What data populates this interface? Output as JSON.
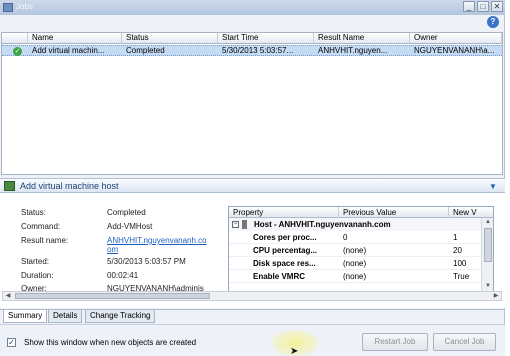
{
  "window": {
    "title": "Jobs"
  },
  "grid": {
    "columns": [
      "Name",
      "Status",
      "Start Time",
      "Result Name",
      "Owner"
    ],
    "rows": [
      {
        "name": "Add virtual machin...",
        "status": "Completed",
        "start_time": "5/30/2013 5:03:57...",
        "result_name": "ANHVHIT.nguyen...",
        "owner": "NGUYENVANANH\\a..."
      }
    ]
  },
  "details": {
    "title": "Add virtual machine host",
    "fields": [
      {
        "label": "Status:",
        "value": "Completed"
      },
      {
        "label": "Command:",
        "value": "Add-VMHost"
      },
      {
        "label": "Result name:",
        "value": "ANHVHIT.nguyenvananh.co",
        "value2": "om"
      },
      {
        "label": "Started:",
        "value": "5/30/2013 5:03:57 PM"
      },
      {
        "label": "Duration:",
        "value": "00:02:41"
      },
      {
        "label": "Owner:",
        "value": "NGUYENVANANH\\adminis"
      }
    ],
    "property_grid": {
      "columns": [
        "Property",
        "Previous Value",
        "New V"
      ],
      "group": "Host - ANHVHIT.nguyenvananh.com",
      "rows": [
        {
          "property": "Cores per proc...",
          "previous": "0",
          "new": "1"
        },
        {
          "property": "CPU percentag...",
          "previous": "(none)",
          "new": "20"
        },
        {
          "property": "Disk space res...",
          "previous": "(none)",
          "new": "100"
        },
        {
          "property": "Enable VMRC",
          "previous": "(none)",
          "new": "True"
        }
      ]
    }
  },
  "tabs": [
    "Summary",
    "Details",
    "Change Tracking"
  ],
  "footer": {
    "checkbox_label": "Show this window when new objects are created",
    "restart_label": "Restart Job",
    "cancel_label": "Cancel Job"
  },
  "colors": {
    "selection": "#c5dbf4",
    "link": "#1f5fc0",
    "title_bar": "#b4c6df"
  }
}
